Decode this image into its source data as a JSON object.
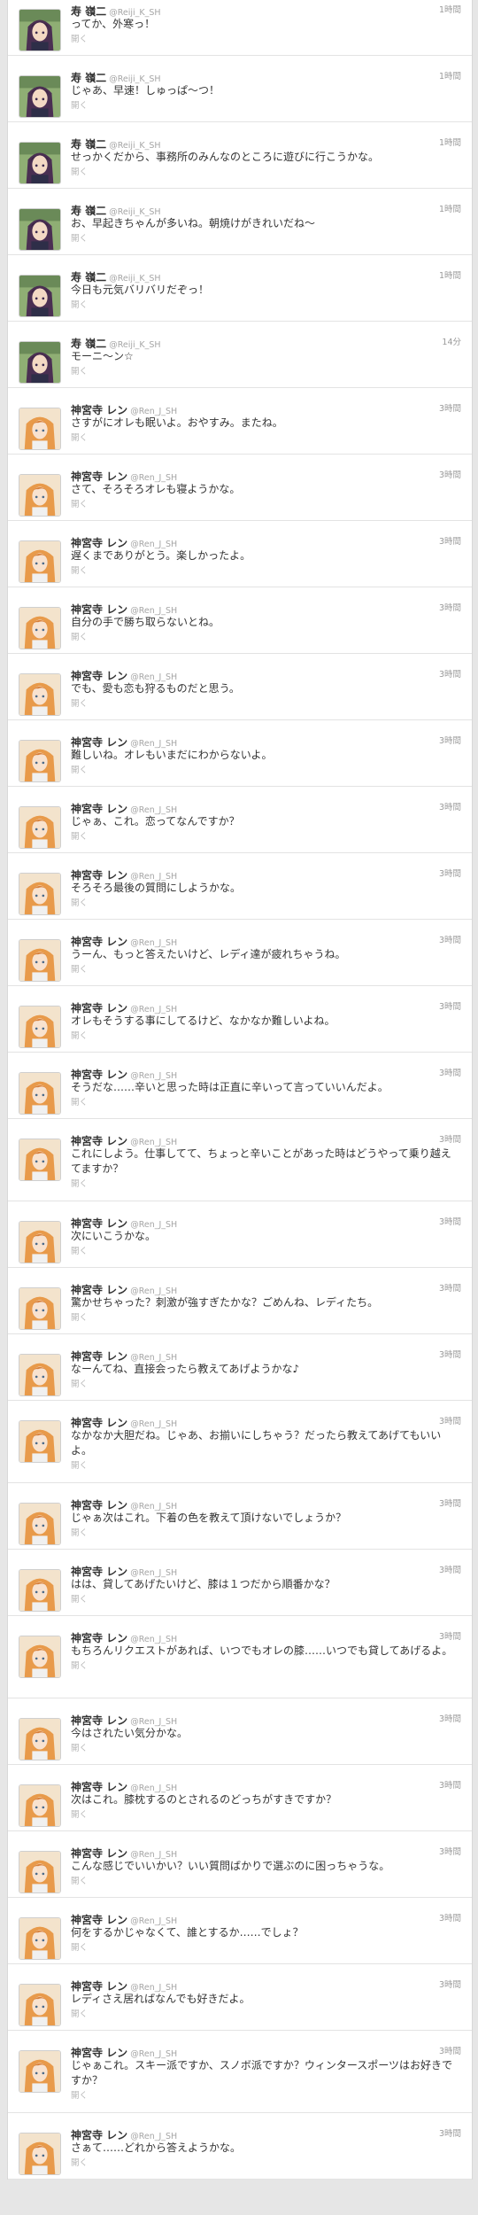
{
  "users": {
    "reiji": {
      "name": "寿 嶺二",
      "handle": "@Reiji_K_SH"
    },
    "ren": {
      "name": "神宮寺 レン",
      "handle": "@Ren_J_SH"
    }
  },
  "open_label": "開く",
  "tweets": [
    {
      "user": "reiji",
      "time": "1時間",
      "text": "ってか、外寒っ！"
    },
    {
      "user": "reiji",
      "time": "1時間",
      "text": "じゃあ、早速！しゅっぱ〜つ！"
    },
    {
      "user": "reiji",
      "time": "1時間",
      "text": "せっかくだから、事務所のみんなのところに遊びに行こうかな。"
    },
    {
      "user": "reiji",
      "time": "1時間",
      "text": "お、早起きちゃんが多いね。朝焼けがきれいだね〜"
    },
    {
      "user": "reiji",
      "time": "1時間",
      "text": "今日も元気バリバリだぞっ！"
    },
    {
      "user": "reiji",
      "time": "14分",
      "text": "モーニ〜ン☆"
    },
    {
      "user": "ren",
      "time": "3時間",
      "text": "さすがにオレも眠いよ。おやすみ。またね。"
    },
    {
      "user": "ren",
      "time": "3時間",
      "text": "さて、そろそろオレも寝ようかな。"
    },
    {
      "user": "ren",
      "time": "3時間",
      "text": "遅くまでありがとう。楽しかったよ。"
    },
    {
      "user": "ren",
      "time": "3時間",
      "text": "自分の手で勝ち取らないとね。"
    },
    {
      "user": "ren",
      "time": "3時間",
      "text": "でも、愛も恋も狩るものだと思う。"
    },
    {
      "user": "ren",
      "time": "3時間",
      "text": "難しいね。オレもいまだにわからないよ。"
    },
    {
      "user": "ren",
      "time": "3時間",
      "text": "じゃぁ、これ。恋ってなんですか？"
    },
    {
      "user": "ren",
      "time": "3時間",
      "text": "そろそろ最後の質問にしようかな。"
    },
    {
      "user": "ren",
      "time": "3時間",
      "text": "うーん、もっと答えたいけど、レディ達が疲れちゃうね。"
    },
    {
      "user": "ren",
      "time": "3時間",
      "text": "オレもそうする事にしてるけど、なかなか難しいよね。"
    },
    {
      "user": "ren",
      "time": "3時間",
      "text": "そうだな……辛いと思った時は正直に辛いって言っていいんだよ。"
    },
    {
      "user": "ren",
      "time": "3時間",
      "text": "これにしよう。仕事してて、ちょっと辛いことがあった時はどうやって乗り越えてますか？"
    },
    {
      "user": "ren",
      "time": "3時間",
      "text": "次にいこうかな。"
    },
    {
      "user": "ren",
      "time": "3時間",
      "text": "驚かせちゃった？刺激が強すぎたかな？ごめんね、レディたち。"
    },
    {
      "user": "ren",
      "time": "3時間",
      "text": "なーんてね、直接会ったら教えてあげようかな♪"
    },
    {
      "user": "ren",
      "time": "3時間",
      "text": "なかなか大胆だね。じゃあ、お揃いにしちゃう？だったら教えてあげてもいいよ。"
    },
    {
      "user": "ren",
      "time": "3時間",
      "text": "じゃぁ次はこれ。下着の色を教えて頂けないでしょうか？"
    },
    {
      "user": "ren",
      "time": "3時間",
      "text": "はは、貸してあげたいけど、膝は１つだから順番かな？"
    },
    {
      "user": "ren",
      "time": "3時間",
      "text": "もちろんリクエストがあれば、いつでもオレの膝……いつでも貸してあげるよ。"
    },
    {
      "user": "ren",
      "time": "3時間",
      "text": "今はされたい気分かな。"
    },
    {
      "user": "ren",
      "time": "3時間",
      "text": "次はこれ。膝枕するのとされるのどっちがすきですか？"
    },
    {
      "user": "ren",
      "time": "3時間",
      "text": "こんな感じでいいかい？いい質問ばかりで選ぶのに困っちゃうな。"
    },
    {
      "user": "ren",
      "time": "3時間",
      "text": "何をするかじゃなくて、誰とするか……でしょ？"
    },
    {
      "user": "ren",
      "time": "3時間",
      "text": "レディさえ居ればなんでも好きだよ。"
    },
    {
      "user": "ren",
      "time": "3時間",
      "text": "じゃぁこれ。スキー派ですか、スノボ派ですか？ウィンタースポーツはお好きですか？"
    },
    {
      "user": "ren",
      "time": "3時間",
      "text": "さぁて……どれから答えようかな。"
    }
  ]
}
